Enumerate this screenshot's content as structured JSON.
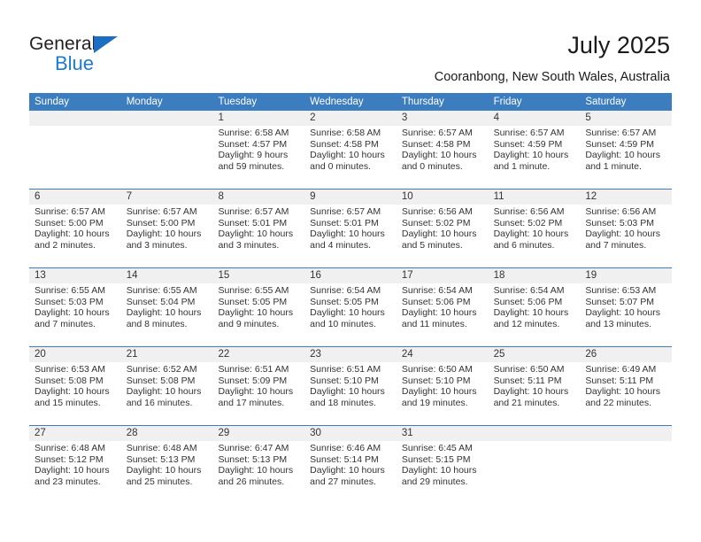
{
  "brand": {
    "name_dark": "General",
    "name_blue": "Blue",
    "accent_color": "#1b6ec2"
  },
  "header": {
    "title": "July 2025",
    "subtitle": "Cooranbong, New South Wales, Australia"
  },
  "calendar": {
    "header_bg": "#3b7dbf",
    "date_band_bg": "#f0f0f0",
    "weekdays": [
      "Sunday",
      "Monday",
      "Tuesday",
      "Wednesday",
      "Thursday",
      "Friday",
      "Saturday"
    ],
    "weeks": [
      [
        {
          "day": "",
          "lines": []
        },
        {
          "day": "",
          "lines": []
        },
        {
          "day": "1",
          "lines": [
            "Sunrise: 6:58 AM",
            "Sunset: 4:57 PM",
            "Daylight: 9 hours",
            "and 59 minutes."
          ]
        },
        {
          "day": "2",
          "lines": [
            "Sunrise: 6:58 AM",
            "Sunset: 4:58 PM",
            "Daylight: 10 hours",
            "and 0 minutes."
          ]
        },
        {
          "day": "3",
          "lines": [
            "Sunrise: 6:57 AM",
            "Sunset: 4:58 PM",
            "Daylight: 10 hours",
            "and 0 minutes."
          ]
        },
        {
          "day": "4",
          "lines": [
            "Sunrise: 6:57 AM",
            "Sunset: 4:59 PM",
            "Daylight: 10 hours",
            "and 1 minute."
          ]
        },
        {
          "day": "5",
          "lines": [
            "Sunrise: 6:57 AM",
            "Sunset: 4:59 PM",
            "Daylight: 10 hours",
            "and 1 minute."
          ]
        }
      ],
      [
        {
          "day": "6",
          "lines": [
            "Sunrise: 6:57 AM",
            "Sunset: 5:00 PM",
            "Daylight: 10 hours",
            "and 2 minutes."
          ]
        },
        {
          "day": "7",
          "lines": [
            "Sunrise: 6:57 AM",
            "Sunset: 5:00 PM",
            "Daylight: 10 hours",
            "and 3 minutes."
          ]
        },
        {
          "day": "8",
          "lines": [
            "Sunrise: 6:57 AM",
            "Sunset: 5:01 PM",
            "Daylight: 10 hours",
            "and 3 minutes."
          ]
        },
        {
          "day": "9",
          "lines": [
            "Sunrise: 6:57 AM",
            "Sunset: 5:01 PM",
            "Daylight: 10 hours",
            "and 4 minutes."
          ]
        },
        {
          "day": "10",
          "lines": [
            "Sunrise: 6:56 AM",
            "Sunset: 5:02 PM",
            "Daylight: 10 hours",
            "and 5 minutes."
          ]
        },
        {
          "day": "11",
          "lines": [
            "Sunrise: 6:56 AM",
            "Sunset: 5:02 PM",
            "Daylight: 10 hours",
            "and 6 minutes."
          ]
        },
        {
          "day": "12",
          "lines": [
            "Sunrise: 6:56 AM",
            "Sunset: 5:03 PM",
            "Daylight: 10 hours",
            "and 7 minutes."
          ]
        }
      ],
      [
        {
          "day": "13",
          "lines": [
            "Sunrise: 6:55 AM",
            "Sunset: 5:03 PM",
            "Daylight: 10 hours",
            "and 7 minutes."
          ]
        },
        {
          "day": "14",
          "lines": [
            "Sunrise: 6:55 AM",
            "Sunset: 5:04 PM",
            "Daylight: 10 hours",
            "and 8 minutes."
          ]
        },
        {
          "day": "15",
          "lines": [
            "Sunrise: 6:55 AM",
            "Sunset: 5:05 PM",
            "Daylight: 10 hours",
            "and 9 minutes."
          ]
        },
        {
          "day": "16",
          "lines": [
            "Sunrise: 6:54 AM",
            "Sunset: 5:05 PM",
            "Daylight: 10 hours",
            "and 10 minutes."
          ]
        },
        {
          "day": "17",
          "lines": [
            "Sunrise: 6:54 AM",
            "Sunset: 5:06 PM",
            "Daylight: 10 hours",
            "and 11 minutes."
          ]
        },
        {
          "day": "18",
          "lines": [
            "Sunrise: 6:54 AM",
            "Sunset: 5:06 PM",
            "Daylight: 10 hours",
            "and 12 minutes."
          ]
        },
        {
          "day": "19",
          "lines": [
            "Sunrise: 6:53 AM",
            "Sunset: 5:07 PM",
            "Daylight: 10 hours",
            "and 13 minutes."
          ]
        }
      ],
      [
        {
          "day": "20",
          "lines": [
            "Sunrise: 6:53 AM",
            "Sunset: 5:08 PM",
            "Daylight: 10 hours",
            "and 15 minutes."
          ]
        },
        {
          "day": "21",
          "lines": [
            "Sunrise: 6:52 AM",
            "Sunset: 5:08 PM",
            "Daylight: 10 hours",
            "and 16 minutes."
          ]
        },
        {
          "day": "22",
          "lines": [
            "Sunrise: 6:51 AM",
            "Sunset: 5:09 PM",
            "Daylight: 10 hours",
            "and 17 minutes."
          ]
        },
        {
          "day": "23",
          "lines": [
            "Sunrise: 6:51 AM",
            "Sunset: 5:10 PM",
            "Daylight: 10 hours",
            "and 18 minutes."
          ]
        },
        {
          "day": "24",
          "lines": [
            "Sunrise: 6:50 AM",
            "Sunset: 5:10 PM",
            "Daylight: 10 hours",
            "and 19 minutes."
          ]
        },
        {
          "day": "25",
          "lines": [
            "Sunrise: 6:50 AM",
            "Sunset: 5:11 PM",
            "Daylight: 10 hours",
            "and 21 minutes."
          ]
        },
        {
          "day": "26",
          "lines": [
            "Sunrise: 6:49 AM",
            "Sunset: 5:11 PM",
            "Daylight: 10 hours",
            "and 22 minutes."
          ]
        }
      ],
      [
        {
          "day": "27",
          "lines": [
            "Sunrise: 6:48 AM",
            "Sunset: 5:12 PM",
            "Daylight: 10 hours",
            "and 23 minutes."
          ]
        },
        {
          "day": "28",
          "lines": [
            "Sunrise: 6:48 AM",
            "Sunset: 5:13 PM",
            "Daylight: 10 hours",
            "and 25 minutes."
          ]
        },
        {
          "day": "29",
          "lines": [
            "Sunrise: 6:47 AM",
            "Sunset: 5:13 PM",
            "Daylight: 10 hours",
            "and 26 minutes."
          ]
        },
        {
          "day": "30",
          "lines": [
            "Sunrise: 6:46 AM",
            "Sunset: 5:14 PM",
            "Daylight: 10 hours",
            "and 27 minutes."
          ]
        },
        {
          "day": "31",
          "lines": [
            "Sunrise: 6:45 AM",
            "Sunset: 5:15 PM",
            "Daylight: 10 hours",
            "and 29 minutes."
          ]
        },
        {
          "day": "",
          "lines": []
        },
        {
          "day": "",
          "lines": []
        }
      ]
    ]
  }
}
